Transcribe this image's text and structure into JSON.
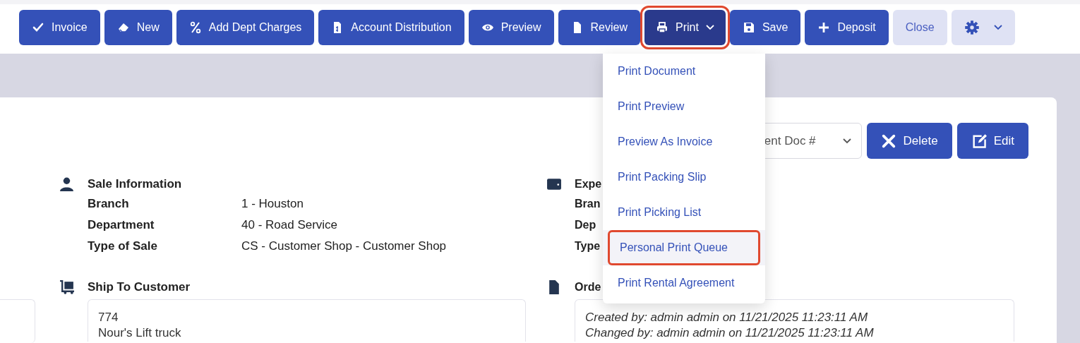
{
  "toolbar": [
    {
      "label": "Invoice",
      "kind": "primary",
      "annotated": false
    },
    {
      "label": "New",
      "kind": "primary",
      "annotated": false
    },
    {
      "label": "Add Dept Charges",
      "kind": "primary",
      "annotated": false
    },
    {
      "label": "Account Distribution",
      "kind": "primary",
      "annotated": false
    },
    {
      "label": "Preview",
      "kind": "primary",
      "annotated": false
    },
    {
      "label": "Review",
      "kind": "primary",
      "annotated": false
    },
    {
      "label": "Print",
      "kind": "dropdown",
      "annotated": true
    },
    {
      "label": "Save",
      "kind": "primary",
      "annotated": false
    },
    {
      "label": "Deposit",
      "kind": "primary",
      "annotated": false
    },
    {
      "label": "Close",
      "kind": "light",
      "annotated": false
    },
    {
      "kind": "settings",
      "annotated": false
    }
  ],
  "print_menu": [
    {
      "label": "Print Document",
      "highlighted": false
    },
    {
      "label": "Print Preview",
      "highlighted": false
    },
    {
      "label": "Preview As Invoice",
      "highlighted": false
    },
    {
      "label": "Print Packing Slip",
      "highlighted": false
    },
    {
      "label": "Print Picking List",
      "highlighted": false
    },
    {
      "label": "Personal Print Queue",
      "highlighted": true
    },
    {
      "label": "Print Rental Agreement",
      "highlighted": false
    }
  ],
  "doc_select": {
    "value": "ent Doc #"
  },
  "actions": [
    {
      "label": "Delete"
    },
    {
      "label": "Edit"
    }
  ],
  "sale_information": {
    "title": "Sale Information",
    "rows": [
      {
        "label": "Branch",
        "value": "1 - Houston"
      },
      {
        "label": "Department",
        "value": "40 - Road Service"
      },
      {
        "label": "Type of Sale",
        "value": "CS - Customer Shop - Customer Shop"
      }
    ]
  },
  "right_section": {
    "title": "Expe",
    "rows": [
      "Bran",
      "Dep",
      "Type"
    ]
  },
  "ship_to_customer": {
    "title": "Ship To Customer",
    "lines": [
      "774",
      "Nour's Lift truck"
    ]
  },
  "order_section": {
    "title": "Orde",
    "lines": [
      "Created by: admin admin on 11/21/2025 11:23:11 AM",
      "Changed by: admin admin on 11/21/2025 11:23:11 AM"
    ]
  }
}
